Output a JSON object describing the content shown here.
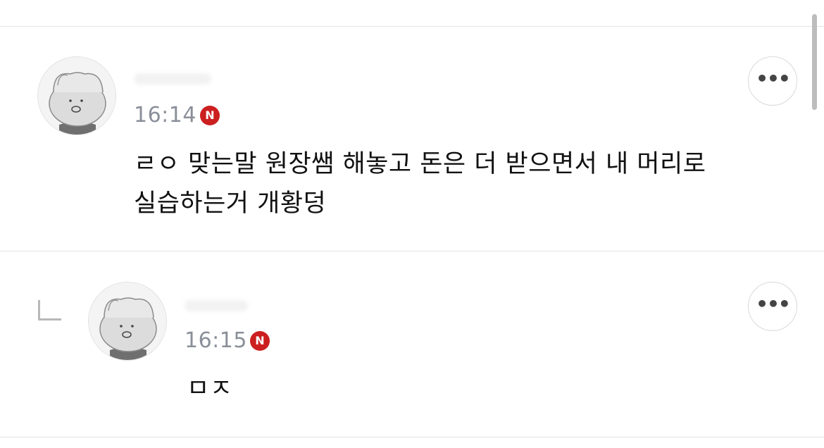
{
  "colors": {
    "badge": "#cc1f1f",
    "time_text": "#8a8f99",
    "comment_text": "#111111"
  },
  "comments": [
    {
      "author_name": "",
      "time": "16:14",
      "badge_label": "N",
      "text_lines": [
        "ㄹㅇ 맞는말 원장쌤 해놓고 돈은 더 받으면서 내 머리로",
        "실습하는거 개황덩"
      ],
      "more_label": "•••",
      "avatar_icon": "cat-avatar-icon",
      "is_reply": false
    },
    {
      "author_name": "",
      "time": "16:15",
      "badge_label": "N",
      "text_lines": [
        "ㅁㅈ"
      ],
      "more_label": "•••",
      "avatar_icon": "cat-avatar-icon",
      "is_reply": true
    }
  ]
}
